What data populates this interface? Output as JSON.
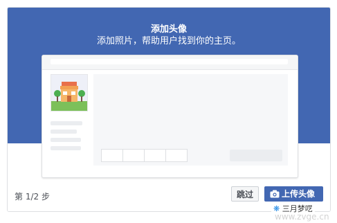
{
  "dialog": {
    "title": "添加头像",
    "subtitle": "添加照片，帮助用户找到你的主页。",
    "header_color": "#4267b2",
    "preview_icon": "storefront-illustration"
  },
  "footer": {
    "step_text": "第 1/2 步",
    "skip_label": "跳过",
    "upload_label": "上传头像",
    "upload_icon": "camera-icon"
  },
  "watermark": {
    "name": "三月梦呓",
    "url": "www.zvge.cn"
  }
}
